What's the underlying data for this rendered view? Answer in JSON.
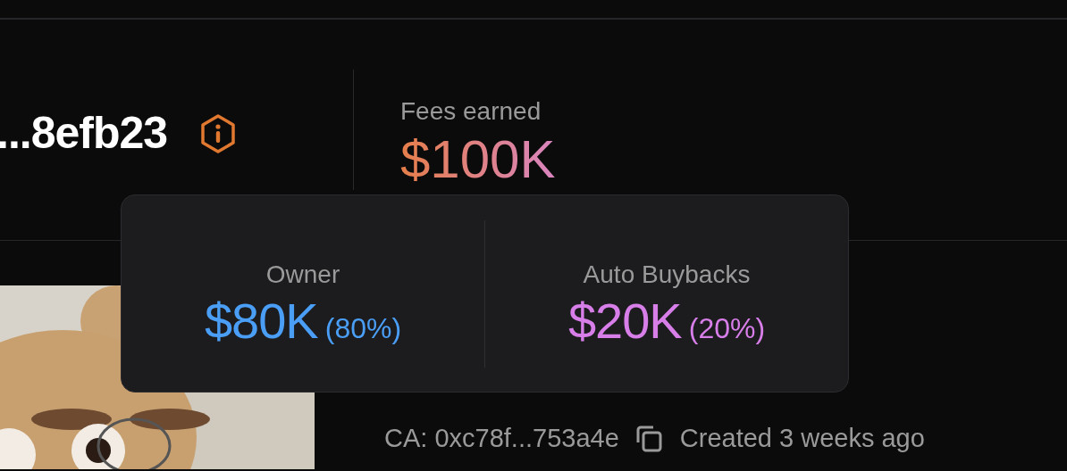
{
  "token": {
    "name": "...8efb23"
  },
  "fees": {
    "label": "Fees earned",
    "value": "$100K"
  },
  "tooltip": {
    "splits": [
      {
        "label": "Owner",
        "value": "$80K",
        "percent": "(80%)",
        "color": "#4a9ef5"
      },
      {
        "label": "Auto Buybacks",
        "value": "$20K",
        "percent": "(20%)",
        "color": "#d77ee8"
      }
    ]
  },
  "meta": {
    "contract": "CA: 0xc78f...753a4e",
    "created": "Created 3 weeks ago"
  }
}
